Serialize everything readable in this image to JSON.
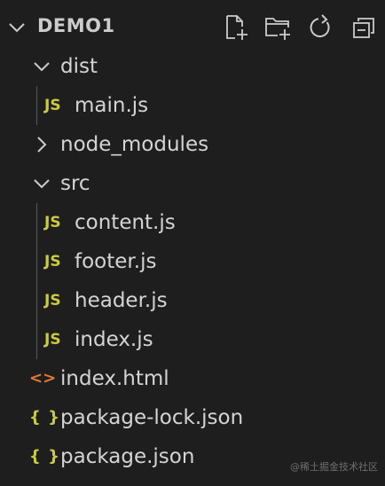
{
  "explorer": {
    "title": "DEMO1",
    "actions": [
      {
        "name": "new-file-icon"
      },
      {
        "name": "new-folder-icon"
      },
      {
        "name": "refresh-icon"
      },
      {
        "name": "collapse-all-icon"
      }
    ]
  },
  "tree": [
    {
      "label": "dist",
      "kind": "folder",
      "expanded": true
    },
    {
      "label": "main.js",
      "kind": "file",
      "badge": "JS"
    },
    {
      "label": "node_modules",
      "kind": "folder",
      "expanded": false
    },
    {
      "label": "src",
      "kind": "folder",
      "expanded": true
    },
    {
      "label": "content.js",
      "kind": "file",
      "badge": "JS"
    },
    {
      "label": "footer.js",
      "kind": "file",
      "badge": "JS"
    },
    {
      "label": "header.js",
      "kind": "file",
      "badge": "JS"
    },
    {
      "label": "index.js",
      "kind": "file",
      "badge": "JS"
    },
    {
      "label": "index.html",
      "kind": "file",
      "badge": "<>"
    },
    {
      "label": "package-lock.json",
      "kind": "file",
      "badge": "{ }"
    },
    {
      "label": "package.json",
      "kind": "file",
      "badge": "{ }"
    }
  ],
  "colors": {
    "background": "#1e1e1e",
    "text": "#d4d4d4",
    "js_icon": "#cbcb41",
    "json_icon": "#cbcb41",
    "html_icon": "#e37933",
    "indent_guide": "#585858"
  },
  "watermark": "@稀土掘金技术社区"
}
